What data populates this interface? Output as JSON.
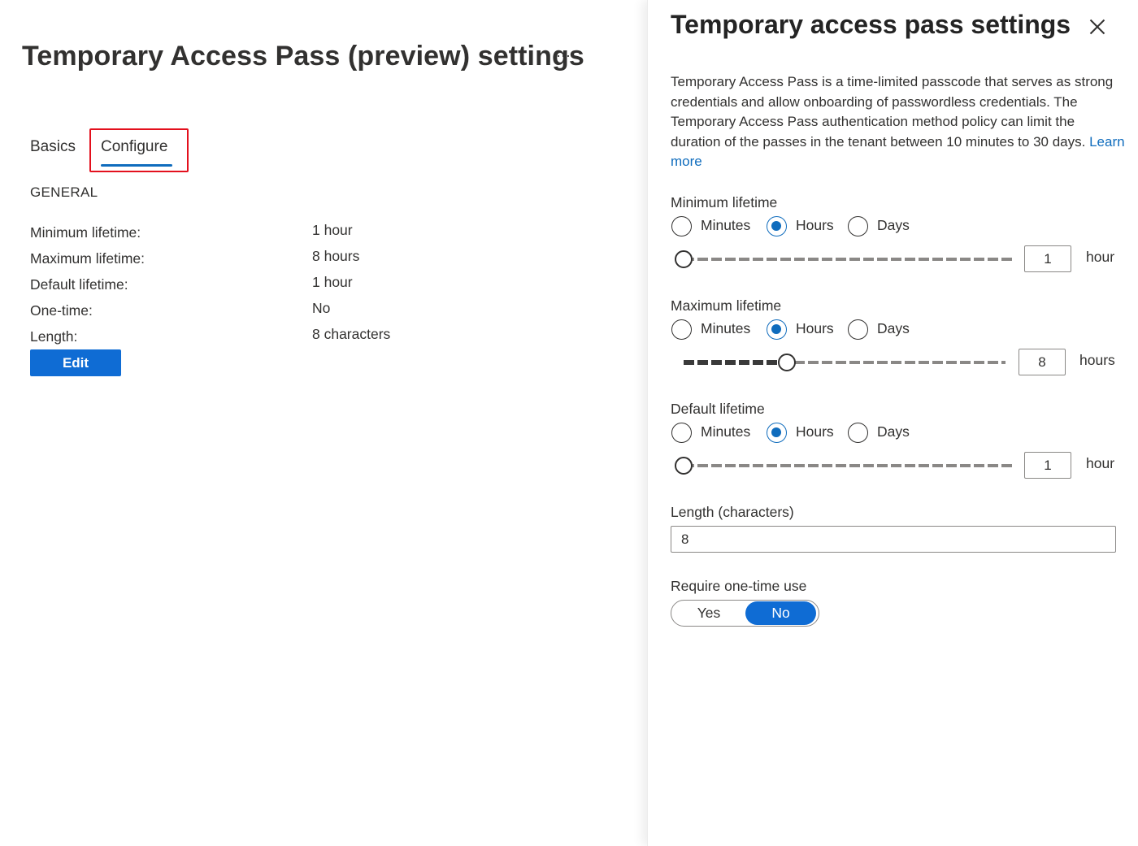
{
  "page": {
    "title": "Temporary Access Pass (preview) settings",
    "more": "···",
    "tabs": [
      {
        "label": "Basics",
        "selected": false
      },
      {
        "label": "Configure",
        "selected": true
      }
    ],
    "section": "GENERAL",
    "summary": [
      {
        "key": "Minimum lifetime:",
        "value": "1 hour"
      },
      {
        "key": "Maximum lifetime:",
        "value": "8 hours"
      },
      {
        "key": "Default lifetime:",
        "value": "1 hour"
      },
      {
        "key": "One-time:",
        "value": "No"
      },
      {
        "key": "Length:",
        "value": "8 characters"
      }
    ],
    "edit_label": "Edit"
  },
  "panel": {
    "title": "Temporary access pass settings",
    "description": "Temporary Access Pass is a time-limited passcode that serves as strong credentials and allow onboarding of passwordless credentials. The Temporary Access Pass authentication method policy can limit the duration of the passes in the tenant between 10 minutes to 30 days.",
    "learn_more": "Learn more",
    "min_lifetime": {
      "label": "Minimum lifetime",
      "options": [
        "Minutes",
        "Hours",
        "Days"
      ],
      "selected": "Hours",
      "value": "1",
      "unit": "hour",
      "slider_fraction": 0.0
    },
    "max_lifetime": {
      "label": "Maximum lifetime",
      "options": [
        "Minutes",
        "Hours",
        "Days"
      ],
      "selected": "Hours",
      "value": "8",
      "unit": "hours",
      "slider_fraction": 0.32
    },
    "default_lifetime": {
      "label": "Default lifetime",
      "options": [
        "Minutes",
        "Hours",
        "Days"
      ],
      "selected": "Hours",
      "value": "1",
      "unit": "hour",
      "slider_fraction": 0.0
    },
    "length": {
      "label": "Length (characters)",
      "value": "8"
    },
    "one_time": {
      "label": "Require one-time use",
      "yes": "Yes",
      "no": "No",
      "selected": "No"
    }
  },
  "colors": {
    "accent": "#0f6cbd",
    "button": "#0f6cd4",
    "highlight_box": "#e3101d"
  }
}
